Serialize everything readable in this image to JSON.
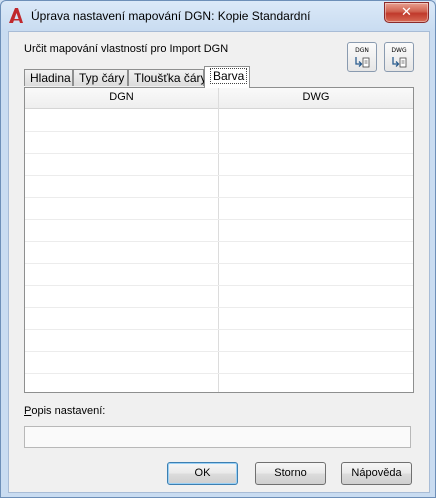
{
  "window": {
    "title": "Úprava nastavení mapování DGN: Kopie Standardní",
    "close_glyph": "✕"
  },
  "main": {
    "heading": "Určit mapování vlastností pro Import DGN",
    "icon_buttons": [
      {
        "label": "DGN",
        "icon": "import-dgn-icon"
      },
      {
        "label": "DWG",
        "icon": "import-dwg-icon"
      }
    ],
    "tabs": [
      {
        "label": "Hladina",
        "active": false
      },
      {
        "label": "Typ čáry",
        "active": false
      },
      {
        "label": "Tloušťka čáry",
        "active": false
      },
      {
        "label": "Barva",
        "active": true
      }
    ],
    "grid": {
      "columns": [
        "DGN",
        "DWG"
      ],
      "rows": []
    },
    "description": {
      "label_first": "P",
      "label_rest": "opis nastavení:",
      "value": ""
    }
  },
  "buttons": {
    "ok": "OK",
    "cancel": "Storno",
    "help": "Nápověda"
  },
  "colors": {
    "accent": "#3c7fb1",
    "app_icon": "#c0282d"
  }
}
